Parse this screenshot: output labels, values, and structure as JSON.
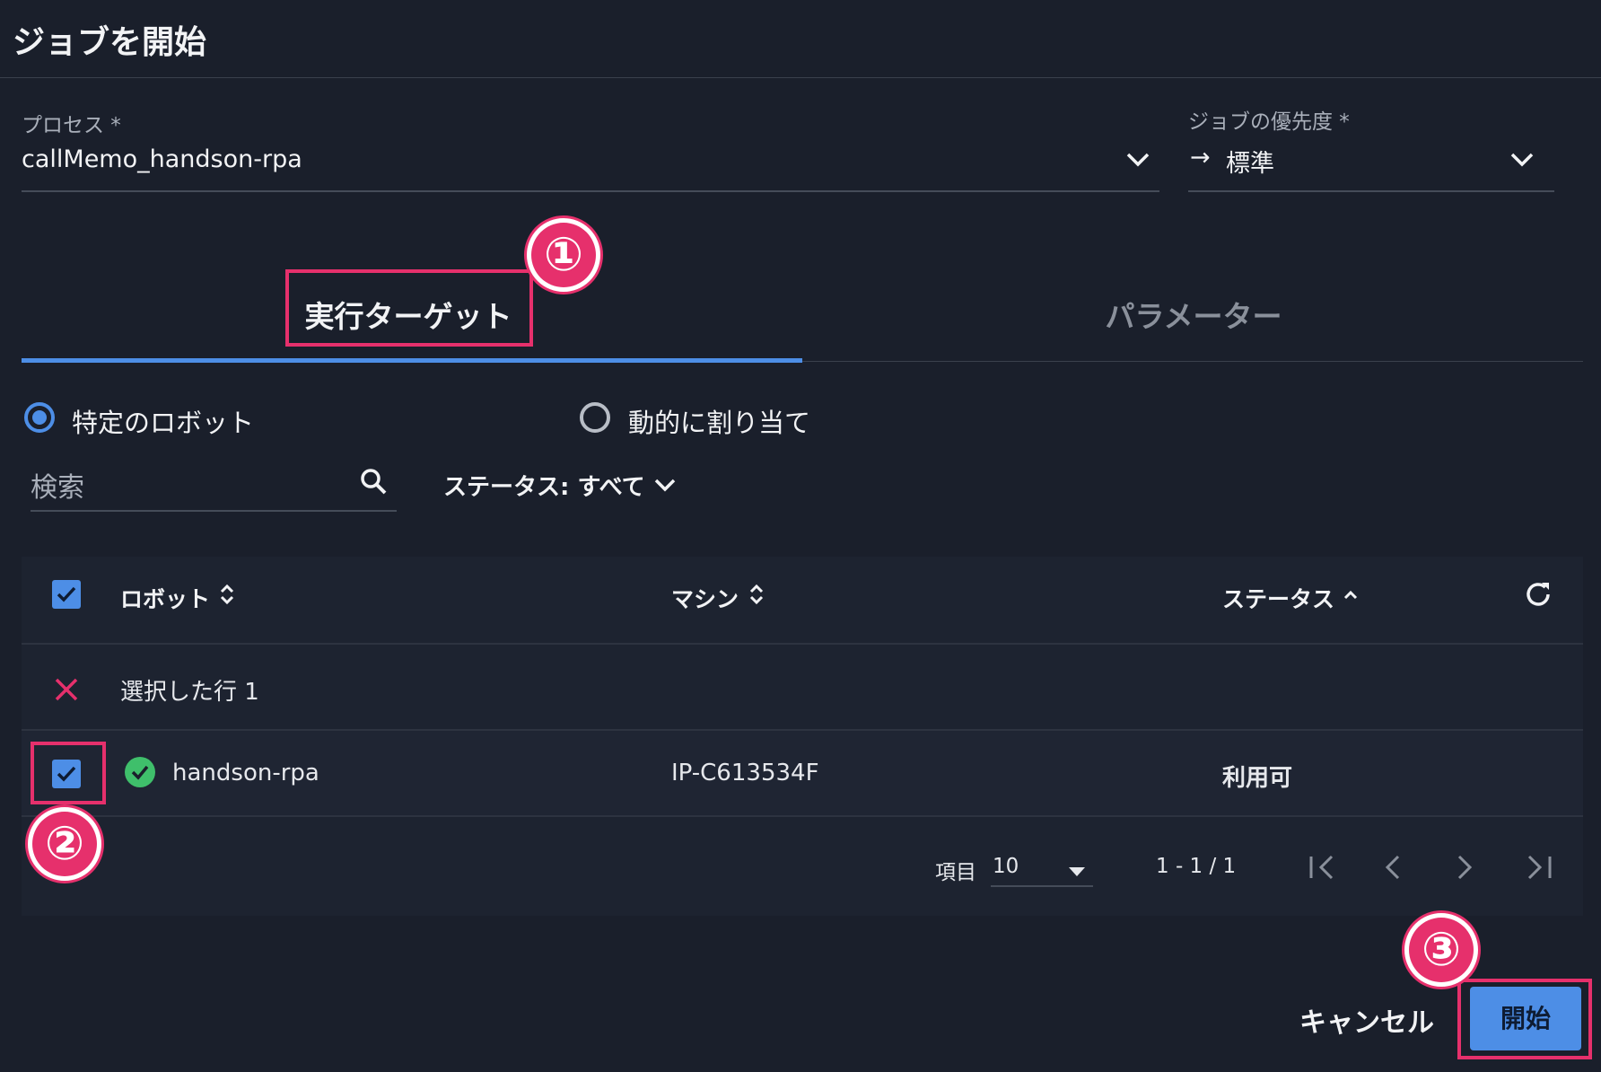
{
  "dialog": {
    "title": "ジョブを開始",
    "process_label": "プロセス *",
    "process_value": "callMemo_handson-rpa",
    "priority_label": "ジョブの優先度 *",
    "priority_arrow": "→",
    "priority_value": "標準"
  },
  "tabs": [
    {
      "label": "実行ターゲット",
      "active": true
    },
    {
      "label": "パラメーター",
      "active": false
    }
  ],
  "target": {
    "radio_specific": "特定のロボット",
    "radio_dynamic": "動的に割り当て",
    "search_placeholder": "検索",
    "status_filter": "ステータス: すべて"
  },
  "table": {
    "headers": {
      "robot": "ロボット",
      "machine": "マシン",
      "status": "ステータス"
    },
    "selected_text": "選択した行 1",
    "rows": [
      {
        "robot": "handson-rpa",
        "machine": "IP-C613534F",
        "status": "利用可"
      }
    ]
  },
  "pagination": {
    "items_label": "項目",
    "page_size": "10",
    "range": "1 - 1 / 1"
  },
  "footer": {
    "cancel": "キャンセル",
    "start": "開始"
  },
  "annotations": [
    "①",
    "②",
    "③"
  ],
  "colors": {
    "background": "#1a1f2b",
    "accent": "#4d8ee6",
    "highlight": "#e6306c",
    "success": "#3fbf6b"
  }
}
